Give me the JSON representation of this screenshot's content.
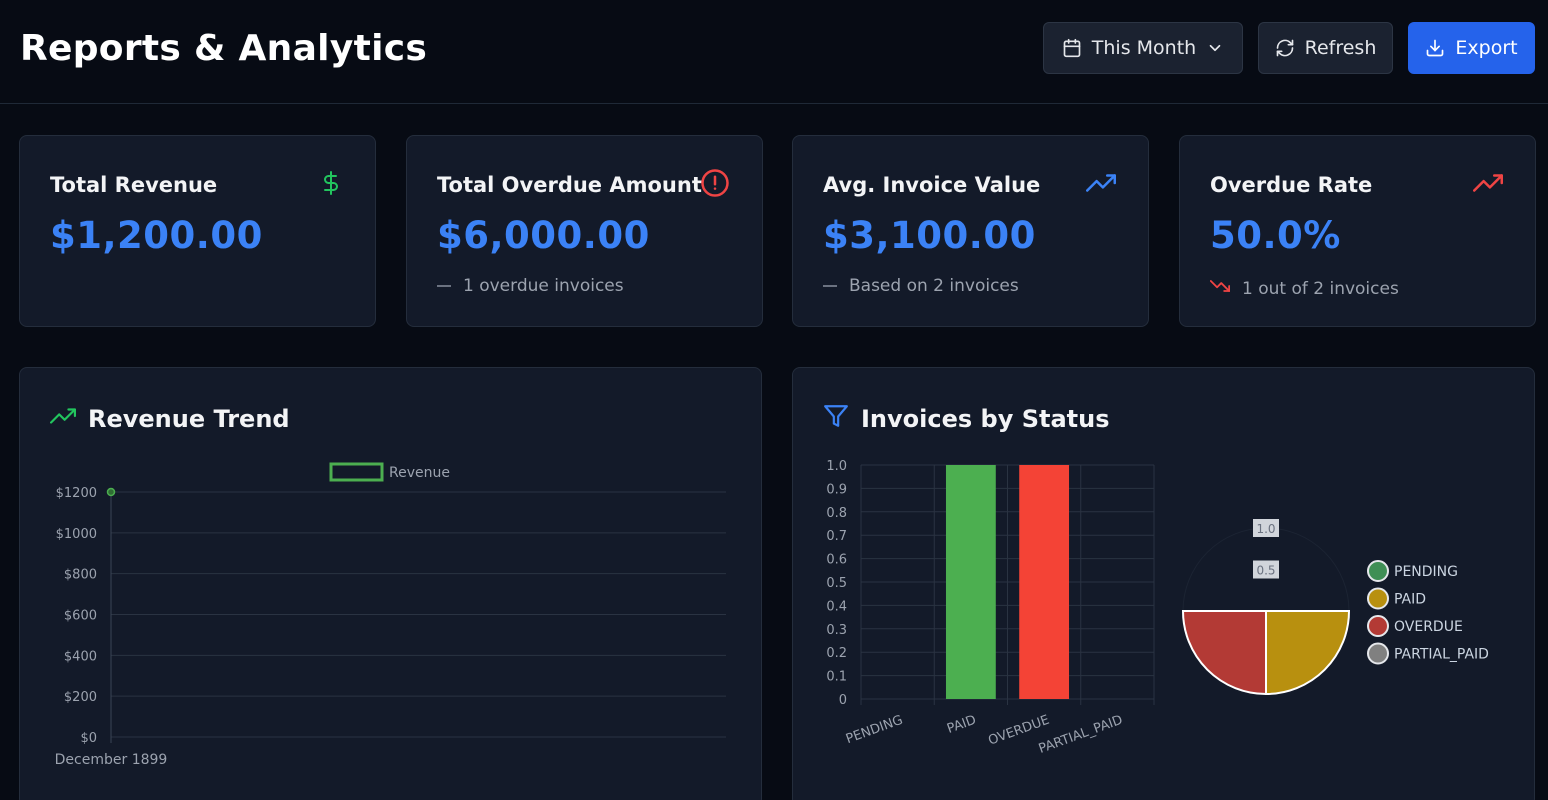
{
  "header": {
    "title": "Reports & Analytics",
    "period_label": "This Month",
    "refresh_label": "Refresh",
    "export_label": "Export"
  },
  "stats": [
    {
      "label": "Total Revenue",
      "value": "$1,200.00",
      "sub": "",
      "icon": "dollar-icon",
      "icon_color": "#22c55e"
    },
    {
      "label": "Total Overdue Amount",
      "value": "$6,000.00",
      "sub": "1 overdue invoices",
      "icon": "alert-circle-icon",
      "icon_color": "#ef4444"
    },
    {
      "label": "Avg. Invoice Value",
      "value": "$3,100.00",
      "sub": "Based on 2 invoices",
      "icon": "trending-up-icon",
      "icon_color": "#3b82f6"
    },
    {
      "label": "Overdue Rate",
      "value": "50.0%",
      "sub": "1 out of 2 invoices",
      "icon": "trending-up-icon",
      "icon_color": "#ef4444"
    }
  ],
  "colors": {
    "accent": "#3b82f6",
    "positive": "#22c55e",
    "negative": "#ef4444",
    "revenue_line": "#4caf50"
  },
  "revenue_chart": {
    "title": "Revenue Trend",
    "chart_data": {
      "type": "line",
      "series": [
        {
          "name": "Revenue",
          "values": [
            1200
          ]
        }
      ],
      "categories": [
        "December 1899"
      ],
      "yticks": [
        "$0",
        "$200",
        "$400",
        "$600",
        "$800",
        "$1000",
        "$1200"
      ],
      "ylim": [
        0,
        1200
      ],
      "grid": true,
      "legend": "top-center"
    }
  },
  "status_chart": {
    "title": "Invoices by Status",
    "bar_chart": {
      "type": "bar",
      "categories": [
        "PENDING",
        "PAID",
        "OVERDUE",
        "PARTIAL_PAID"
      ],
      "values": [
        0,
        1,
        1,
        0
      ],
      "colors": [
        "#3f8f55",
        "#4caf50",
        "#f44336",
        "#808080"
      ],
      "yticks": [
        "0",
        "0.1",
        "0.2",
        "0.3",
        "0.4",
        "0.5",
        "0.6",
        "0.7",
        "0.8",
        "0.9",
        "1.0"
      ],
      "ylim": [
        0,
        1
      ],
      "grid": true
    },
    "polar_chart": {
      "type": "pie",
      "categories": [
        "PENDING",
        "PAID",
        "OVERDUE",
        "PARTIAL_PAID"
      ],
      "values": [
        0,
        1,
        1,
        0
      ],
      "colors": [
        "#3f8f55",
        "#b8900f",
        "#b33a35",
        "#808080"
      ],
      "rticks": [
        "0.5",
        "1.0"
      ],
      "legend": "right"
    }
  }
}
